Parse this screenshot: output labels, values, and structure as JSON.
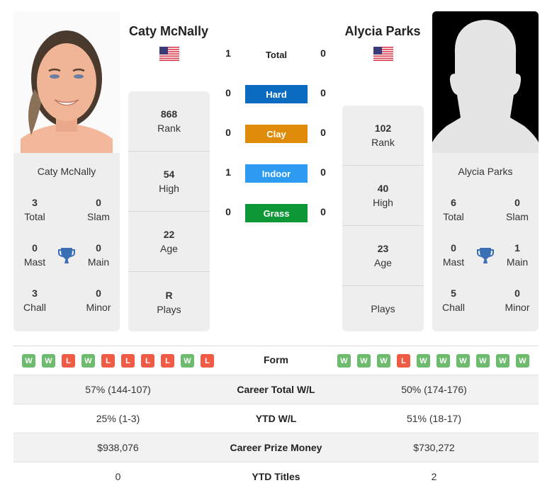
{
  "players": {
    "left": {
      "name": "Caty McNally",
      "country_flag": "usa-flag-icon",
      "photo": "player-photo",
      "titles": {
        "total": {
          "value": "3",
          "label": "Total"
        },
        "slam": {
          "value": "0",
          "label": "Slam"
        },
        "mast": {
          "value": "0",
          "label": "Mast"
        },
        "main": {
          "value": "0",
          "label": "Main"
        },
        "chall": {
          "value": "3",
          "label": "Chall"
        },
        "minor": {
          "value": "0",
          "label": "Minor"
        }
      },
      "stats": [
        {
          "value": "868",
          "label": "Rank"
        },
        {
          "value": "54",
          "label": "High"
        },
        {
          "value": "22",
          "label": "Age"
        },
        {
          "value": "R",
          "label": "Plays"
        }
      ],
      "form": [
        "W",
        "W",
        "L",
        "W",
        "L",
        "L",
        "L",
        "L",
        "W",
        "L"
      ]
    },
    "right": {
      "name": "Alycia Parks",
      "country_flag": "usa-flag-icon",
      "photo": "silhouette-placeholder",
      "titles": {
        "total": {
          "value": "6",
          "label": "Total"
        },
        "slam": {
          "value": "0",
          "label": "Slam"
        },
        "mast": {
          "value": "0",
          "label": "Mast"
        },
        "main": {
          "value": "1",
          "label": "Main"
        },
        "chall": {
          "value": "5",
          "label": "Chall"
        },
        "minor": {
          "value": "0",
          "label": "Minor"
        }
      },
      "stats": [
        {
          "value": "102",
          "label": "Rank"
        },
        {
          "value": "40",
          "label": "High"
        },
        {
          "value": "23",
          "label": "Age"
        },
        {
          "value": "",
          "label": "Plays"
        }
      ],
      "form": [
        "W",
        "W",
        "W",
        "L",
        "W",
        "W",
        "W",
        "W",
        "W",
        "W"
      ]
    }
  },
  "h2h": [
    {
      "label": "Total",
      "left": "1",
      "right": "0",
      "color": ""
    },
    {
      "label": "Hard",
      "left": "0",
      "right": "0",
      "color": "#0b6bc1"
    },
    {
      "label": "Clay",
      "left": "0",
      "right": "0",
      "color": "#de8c0a"
    },
    {
      "label": "Indoor",
      "left": "1",
      "right": "0",
      "color": "#2d9bf0"
    },
    {
      "label": "Grass",
      "left": "0",
      "right": "0",
      "color": "#0d9737"
    }
  ],
  "form_label": "Form",
  "colors": {
    "win": "#6dbb6d",
    "loss": "#ef5b45",
    "trophy": "#3a6fb5"
  },
  "comparison": [
    {
      "label": "Career Total W/L",
      "left": "57% (144-107)",
      "right": "50% (174-176)"
    },
    {
      "label": "YTD W/L",
      "left": "25% (1-3)",
      "right": "51% (18-17)"
    },
    {
      "label": "Career Prize Money",
      "left": "$938,076",
      "right": "$730,272"
    },
    {
      "label": "YTD Titles",
      "left": "0",
      "right": "2"
    }
  ]
}
